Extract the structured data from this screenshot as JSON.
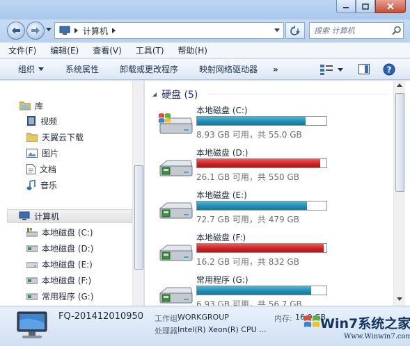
{
  "address": {
    "path": "计算机"
  },
  "search": {
    "placeholder": "搜索 计算机"
  },
  "menu": [
    "文件(F)",
    "编辑(E)",
    "查看(V)",
    "工具(T)",
    "帮助(H)"
  ],
  "toolbar": {
    "organize": "组织",
    "system_properties": "系统属性",
    "uninstall": "卸载或更改程序",
    "map_drive": "映射网络驱动器",
    "more": "»"
  },
  "nav": {
    "libraries": "库",
    "items": [
      "视频",
      "天翼云下载",
      "图片",
      "文档",
      "音乐"
    ],
    "computer": "计算机",
    "drives": [
      "本地磁盘 (C:)",
      "本地磁盘 (D:)",
      "本地磁盘 (E:)",
      "本地磁盘 (F:)",
      "常用程序 (G:)"
    ]
  },
  "content": {
    "group_title": "硬盘 (5)",
    "drives": [
      {
        "name": "本地磁盘 (C:)",
        "info": "8.93 GB 可用，共 55.0 GB",
        "used_fraction": 0.84,
        "bar_color": "blue"
      },
      {
        "name": "本地磁盘 (D:)",
        "info": "26.1 GB 可用，共 550 GB",
        "used_fraction": 0.95,
        "bar_color": "red"
      },
      {
        "name": "本地磁盘 (E:)",
        "info": "72.7 GB 可用，共 479 GB",
        "used_fraction": 0.85,
        "bar_color": "blue"
      },
      {
        "name": "本地磁盘 (F:)",
        "info": "16.2 GB 可用，共 832 GB",
        "used_fraction": 0.98,
        "bar_color": "red"
      },
      {
        "name": "常用程序 (G:)",
        "info": "6.93 GB 可用，共 56.7 GB",
        "used_fraction": 0.88,
        "bar_color": "blue"
      }
    ]
  },
  "details": {
    "computer_name": "FQ-201412010950",
    "workgroup_label": "工作组:",
    "workgroup": "WORKGROUP",
    "memory_label": "内存:",
    "memory": "16.0 GB",
    "processor_label": "处理器:",
    "processor": "Intel(R) Xeon(R) CPU ..."
  },
  "watermark": {
    "title": "Win7系统之家",
    "url": "Www.Winwin7.com"
  },
  "colors": {
    "bar_blue": "#1f8ab0",
    "bar_red": "#cc1e1e",
    "link_blue": "#1e3287"
  }
}
